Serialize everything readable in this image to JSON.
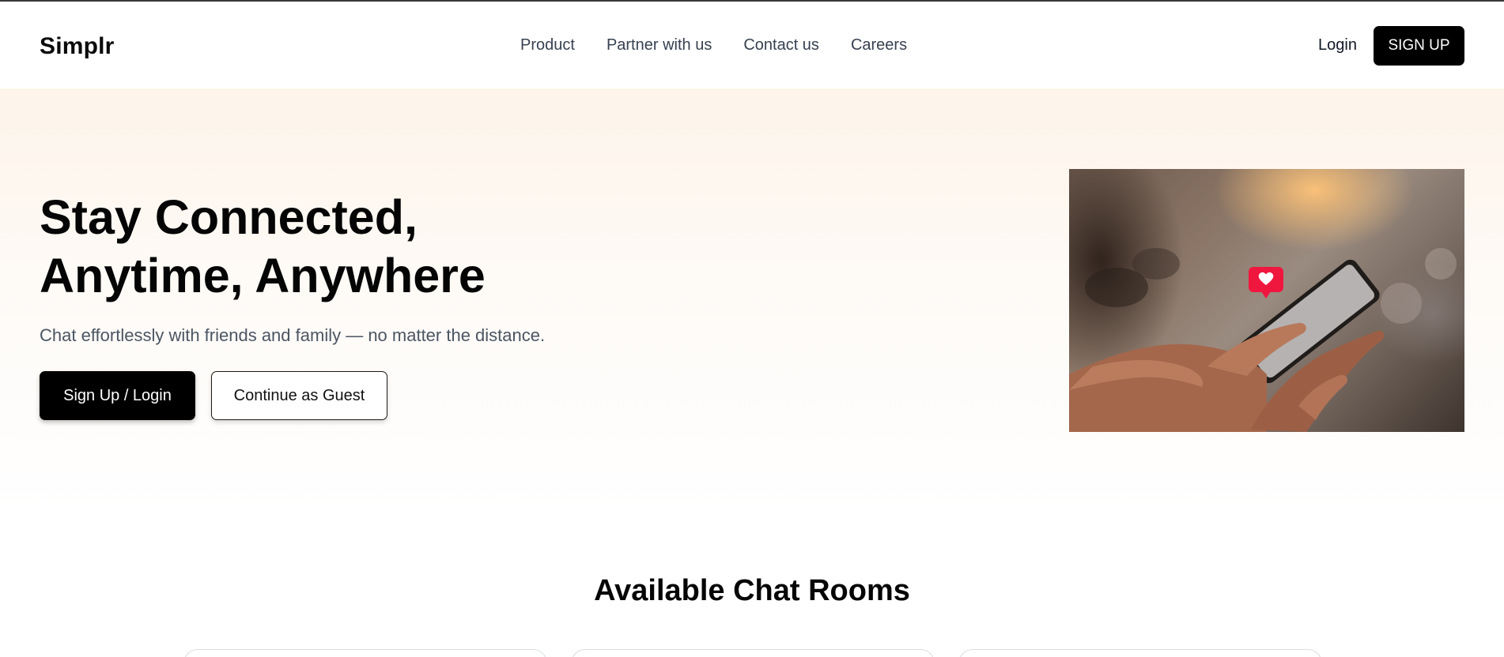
{
  "header": {
    "logo": "Simplr",
    "nav": [
      "Product",
      "Partner with us",
      "Contact us",
      "Careers"
    ],
    "login_label": "Login",
    "signup_label": "SIGN UP"
  },
  "hero": {
    "title_line1": "Stay Connected,",
    "title_line2": "Anytime, Anywhere",
    "subtitle": "Chat effortlessly with friends and family — no matter the distance.",
    "primary_cta": "Sign Up / Login",
    "secondary_cta": "Continue as Guest",
    "image_icon": "heart-message-icon"
  },
  "chat_rooms": {
    "title": "Available Chat Rooms"
  },
  "colors": {
    "brand": "#000000",
    "hero_bg": "#fdf4ea",
    "notification": "#f0173f"
  }
}
